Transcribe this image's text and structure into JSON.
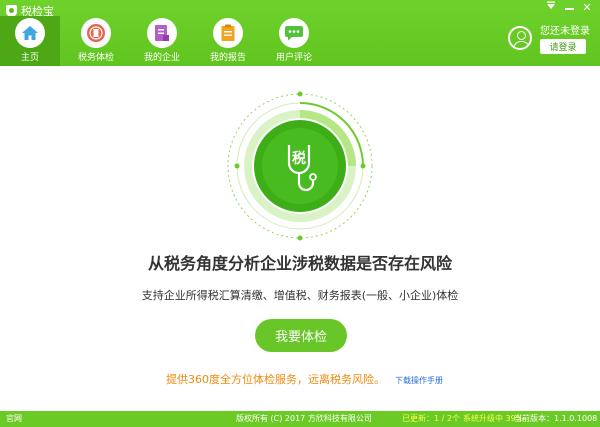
{
  "app": {
    "title": "税检宝"
  },
  "window_controls": [
    "menu-icon",
    "minimize-icon",
    "close-icon"
  ],
  "nav": [
    {
      "label": "主页",
      "icon": "home-icon",
      "active": true
    },
    {
      "label": "税务体检",
      "icon": "tax-seal-icon",
      "active": false
    },
    {
      "label": "我的企业",
      "icon": "company-doc-icon",
      "active": false
    },
    {
      "label": "我的报告",
      "icon": "report-icon",
      "active": false
    },
    {
      "label": "用户评论",
      "icon": "comment-icon",
      "active": false
    }
  ],
  "user": {
    "status": "您还未登录",
    "login_button": "请登录"
  },
  "gauge": {
    "glyph": "税",
    "icon": "stethoscope-icon"
  },
  "main": {
    "headline": "从税务角度分析企业涉税数据是否存在风险",
    "subline": "支持企业所得税汇算清缴、增值税、财务报表(一般、小企业)体检",
    "check_button": "我要体检",
    "service_text": "提供360度全方位体检服务，远离税务风险。",
    "manual_link": "下载操作手册"
  },
  "statusbar": {
    "website": "官网",
    "copyright": "版权所有 (C) 2017 方欣科技有限公司",
    "updated": "已更新：1 / 2个",
    "upgrade": "系统升级中 39%",
    "version": "当前版本：1.1.0.1008"
  },
  "colors": {
    "brand_green": "#6cca26",
    "accent_orange": "#f08a11",
    "link_blue": "#2a6fd6"
  }
}
